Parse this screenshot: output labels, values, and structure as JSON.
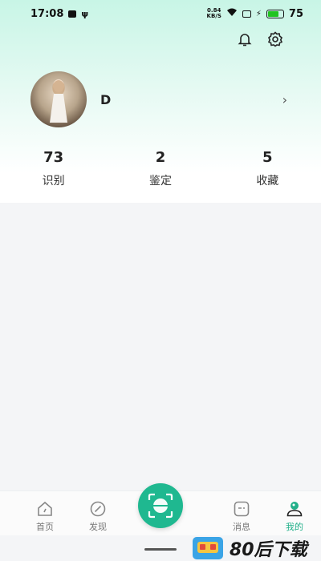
{
  "status_bar": {
    "time": "17:08",
    "net_speed_value": "0.84",
    "net_speed_unit": "KB/S",
    "battery_level": "75",
    "battery_fraction": 0.75,
    "battery_color": "#21c321"
  },
  "header": {
    "notification_icon": "bell-icon",
    "settings_icon": "gear-icon"
  },
  "profile": {
    "username": "D",
    "chevron": "›"
  },
  "stats": [
    {
      "value": "73",
      "label": "识别"
    },
    {
      "value": "2",
      "label": "鉴定"
    },
    {
      "value": "5",
      "label": "收藏"
    }
  ],
  "bottom_nav": {
    "items": [
      {
        "label": "首页",
        "icon": "home-icon"
      },
      {
        "label": "发现",
        "icon": "compass-icon"
      },
      {
        "label": "消息",
        "icon": "message-icon"
      },
      {
        "label": "我的",
        "icon": "profile-icon",
        "active": true
      }
    ],
    "scan_icon": "scan-icon",
    "accent_color": "#1fb890"
  },
  "watermark": {
    "text": "80后下载"
  }
}
